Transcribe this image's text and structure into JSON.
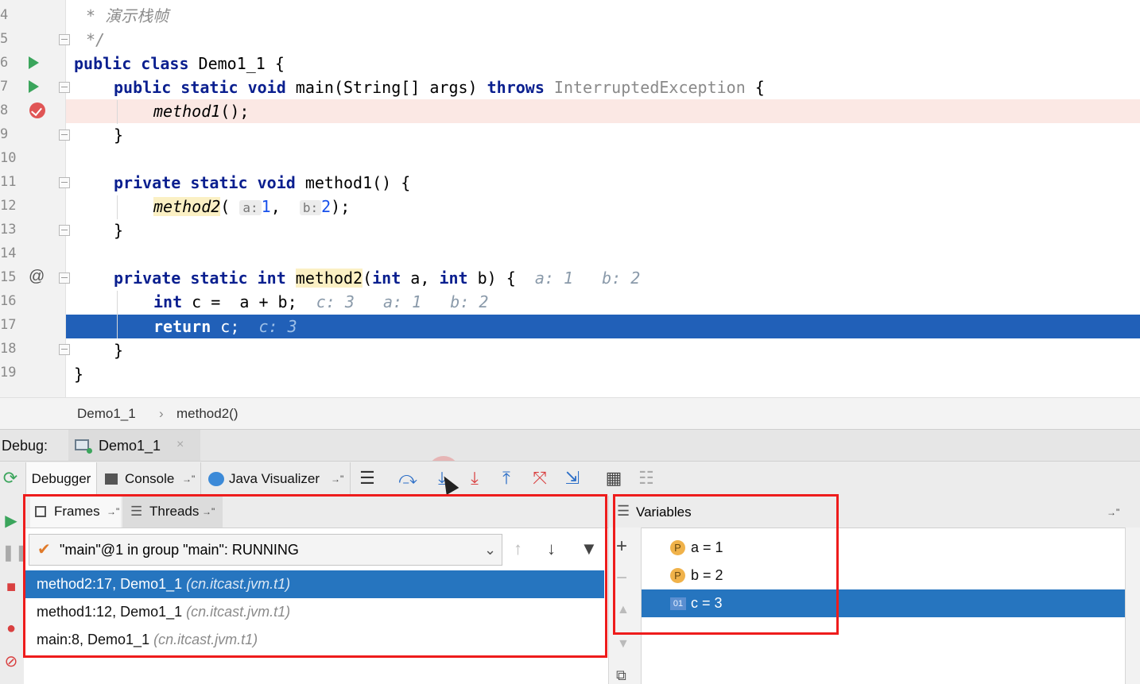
{
  "editor": {
    "line_numbers": [
      "4",
      "5",
      "6",
      "7",
      "8",
      "9",
      "10",
      "11",
      "12",
      "13",
      "14",
      "15",
      "16",
      "17",
      "18",
      "19"
    ],
    "lines": {
      "l4_comment": "* 演示栈帧",
      "l5_comment": "*/",
      "l6_kw": "public class",
      "l6_rest": " Demo1_1 {",
      "l7_kw1": "public static void",
      "l7_rest": " main(String[] args) ",
      "l7_kw2": "throws",
      "l7_exc": " InterruptedException",
      "l7_end": " {",
      "l8_call": "method1",
      "l8_end": "();",
      "l9": "}",
      "l11_kw": "private static void",
      "l11_rest": " method1() {",
      "l12_call": "method2",
      "l12_open": "(",
      "l12_hint_a": "a:",
      "l12_val_a": "1",
      "l12_comma": ",",
      "l12_hint_b": "b:",
      "l12_val_b": "2",
      "l12_end": ");",
      "l13": "}",
      "l15_kw1": "private static int",
      "l15_name": "method2",
      "l15_open": "(",
      "l15_int1": "int",
      "l15_a": " a",
      "l15_comma": ",",
      "l15_int2": "int",
      "l15_b": " b",
      "l15_end": ") {",
      "l15_hint": "a: 1   b: 2",
      "l16_int": "int",
      "l16_rest": " c =  a + b;",
      "l16_hint": "c: 3   a: 1   b: 2",
      "l17_kw": "return",
      "l17_rest": " c;",
      "l17_hint": "c: 3",
      "l18": "}",
      "l19": "}"
    }
  },
  "breadcrumb": {
    "class": "Demo1_1",
    "sep": "›",
    "method": "method2()"
  },
  "debug": {
    "label": "Debug:",
    "tab": "Demo1_1",
    "close": "×"
  },
  "toolbar": {
    "debugger": "Debugger",
    "console": "Console",
    "java_visualizer": "Java Visualizer",
    "pin": "→\""
  },
  "frames": {
    "tab_frames": "Frames",
    "tab_threads": "Threads",
    "thread": "\"main\"@1 in group \"main\": RUNNING",
    "items": [
      {
        "label": "method2:17, Demo1_1",
        "pkg": "(cn.itcast.jvm.t1)"
      },
      {
        "label": "method1:12, Demo1_1",
        "pkg": "(cn.itcast.jvm.t1)"
      },
      {
        "label": "main:8, Demo1_1",
        "pkg": "(cn.itcast.jvm.t1)"
      }
    ]
  },
  "variables": {
    "title": "Variables",
    "items": [
      {
        "badge": "P",
        "text": "a = 1"
      },
      {
        "badge": "P",
        "text": "b = 2"
      },
      {
        "badge": "01",
        "text": "c = 3"
      }
    ]
  },
  "colors": {
    "keyword": "#0a1f8f",
    "selection": "#2675bf",
    "current_line": "#2160b8",
    "breakpoint_line": "#fbe8e4",
    "annotation_red": "#ee1c1c"
  }
}
